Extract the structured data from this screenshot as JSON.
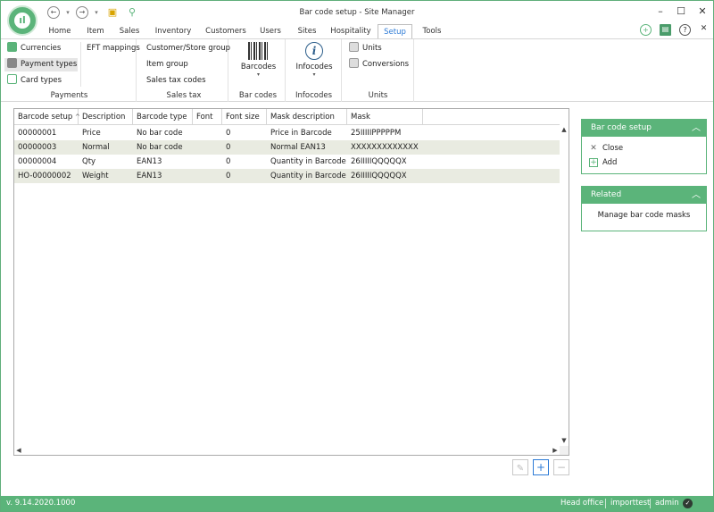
{
  "window": {
    "title": "Bar code setup - Site Manager"
  },
  "tabs": [
    {
      "label": "Home",
      "active": false
    },
    {
      "label": "Item",
      "active": false
    },
    {
      "label": "Sales",
      "active": false
    },
    {
      "label": "Inventory",
      "active": false
    },
    {
      "label": "Customers",
      "active": false
    },
    {
      "label": "Users",
      "active": false
    },
    {
      "label": "Sites",
      "active": false
    },
    {
      "label": "Hospitality",
      "active": false
    },
    {
      "label": "Setup",
      "active": true
    },
    {
      "label": "Tools",
      "active": false
    }
  ],
  "ribbon": {
    "payments": {
      "label": "Payments",
      "currencies": "Currencies",
      "payment_types": "Payment types",
      "card_types": "Card types",
      "eft_mappings": "EFT mappings"
    },
    "sales_tax": {
      "label": "Sales tax",
      "customer_store_group": "Customer/Store group",
      "item_group": "Item group",
      "sales_tax_codes": "Sales tax codes"
    },
    "bar_codes": {
      "label": "Bar codes",
      "button": "Barcodes"
    },
    "infocodes": {
      "label": "Infocodes",
      "button": "Infocodes"
    },
    "units": {
      "label": "Units",
      "units": "Units",
      "conversions": "Conversions"
    }
  },
  "grid": {
    "columns": [
      "Barcode setup",
      "Description",
      "Barcode type",
      "Font",
      "Font size",
      "Mask description",
      "Mask"
    ],
    "sort_indicator": "^",
    "rows": [
      {
        "setup": "00000001",
        "description": "Price",
        "type": "No bar code",
        "font": "",
        "font_size": "0",
        "mask_description": "Price in Barcode",
        "mask": "25IIIIIPPPPPM"
      },
      {
        "setup": "00000003",
        "description": "Normal",
        "type": "No bar code",
        "font": "",
        "font_size": "0",
        "mask_description": "Normal EAN13",
        "mask": "XXXXXXXXXXXXX"
      },
      {
        "setup": "00000004",
        "description": "Qty",
        "type": "EAN13",
        "font": "",
        "font_size": "0",
        "mask_description": "Quantity in Barcode",
        "mask": "26IIIIIQQQQQX"
      },
      {
        "setup": "HO-00000002",
        "description": "Weight",
        "type": "EAN13",
        "font": "",
        "font_size": "0",
        "mask_description": "Quantity in Barcode",
        "mask": "26IIIIIQQQQQX"
      }
    ]
  },
  "panels": {
    "barcode_setup": {
      "title": "Bar code setup",
      "close": "Close",
      "add": "Add"
    },
    "related": {
      "title": "Related",
      "manage": "Manage bar code masks"
    }
  },
  "status": {
    "version": "v. 9.14.2020.1000",
    "store": "Head office",
    "database": "importtest",
    "user": "admin"
  },
  "colors": {
    "accent": "#5bb47a",
    "alt_row": "#e9ebe1",
    "link_blue": "#2e7bd6"
  }
}
